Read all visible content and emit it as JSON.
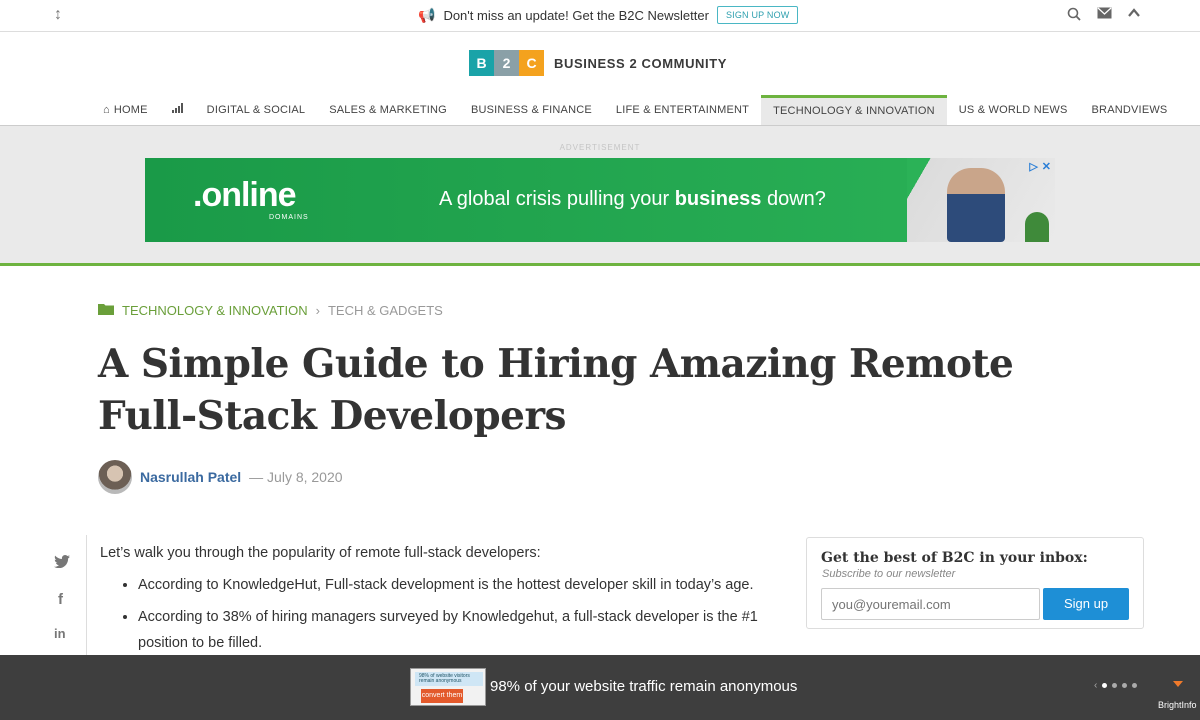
{
  "topbar": {
    "promo_text": "Don't miss an update! Get the B2C Newsletter",
    "signup_label": "SIGN UP NOW"
  },
  "logo": {
    "b": "B",
    "two": "2",
    "c": "C",
    "name": "BUSINESS 2 COMMUNITY"
  },
  "nav": {
    "items": [
      {
        "label": "HOME"
      },
      {
        "label": ""
      },
      {
        "label": "DIGITAL & SOCIAL"
      },
      {
        "label": "SALES & MARKETING"
      },
      {
        "label": "BUSINESS & FINANCE"
      },
      {
        "label": "LIFE & ENTERTAINMENT"
      },
      {
        "label": "TECHNOLOGY & INNOVATION",
        "active": true
      },
      {
        "label": "US & WORLD NEWS"
      },
      {
        "label": "BRANDVIEWS"
      }
    ]
  },
  "ad": {
    "label": "ADVERTISEMENT",
    "brand": ".online",
    "brand_sub": "DOMAINS",
    "tagline_pre": "A global crisis pulling your ",
    "tagline_bold": "business",
    "tagline_post": " down?"
  },
  "article": {
    "category": "TECHNOLOGY & INNOVATION",
    "subcategory": "TECH & GADGETS",
    "title": "A Simple Guide to Hiring Amazing Remote Full-Stack Developers",
    "author": "Nasrullah Patel",
    "date": "— July 8, 2020",
    "intro": "Let’s walk you through the popularity of remote full-stack developers:",
    "bullets": [
      "According to KnowledgeHut, Full-stack development is the hottest developer skill in today’s age.",
      "According to 38% of hiring managers surveyed by Knowledgehut, a full-stack developer is the #1 position to be filled."
    ]
  },
  "newsletter": {
    "heading": "Get the best of B2C in your inbox:",
    "subheading": "Subscribe to our newsletter",
    "placeholder": "you@youremail.com",
    "button": "Sign up"
  },
  "footer": {
    "thumb_top": "98% of website visitors remain anonymous",
    "thumb_btn": "convert them",
    "message": "98% of your website traffic remain anonymous",
    "brand": "BrightInfo"
  },
  "colors": {
    "accent_green": "#6db33f",
    "link_blue": "#3b6aa0",
    "button_blue": "#1e8fd6",
    "footer_bg": "#3e3e3e"
  }
}
